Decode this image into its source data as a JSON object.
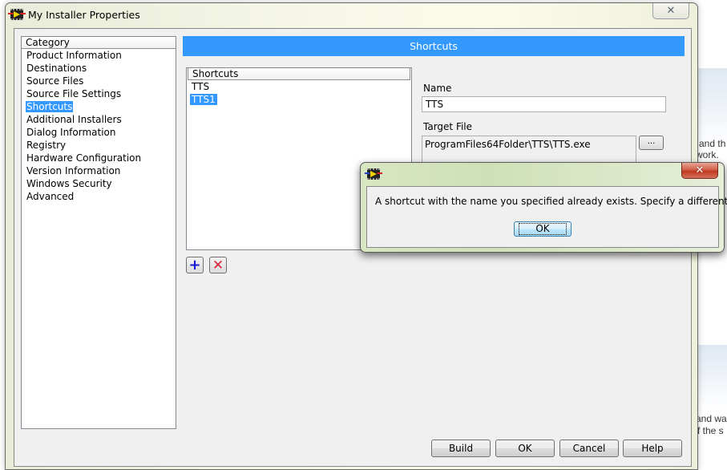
{
  "background": {
    "fragments": [
      "and th",
      "work.",
      "and wa",
      "f the s"
    ]
  },
  "window": {
    "title": "My Installer Properties",
    "close_glyph": "✕"
  },
  "category": {
    "header": "Category",
    "items": [
      {
        "label": "Product Information",
        "selected": false
      },
      {
        "label": "Destinations",
        "selected": false
      },
      {
        "label": "Source Files",
        "selected": false
      },
      {
        "label": "Source File Settings",
        "selected": false
      },
      {
        "label": "Shortcuts",
        "selected": true
      },
      {
        "label": "Additional Installers",
        "selected": false
      },
      {
        "label": "Dialog Information",
        "selected": false
      },
      {
        "label": "Registry",
        "selected": false
      },
      {
        "label": "Hardware Configuration",
        "selected": false
      },
      {
        "label": "Version Information",
        "selected": false
      },
      {
        "label": "Windows Security",
        "selected": false
      },
      {
        "label": "Advanced",
        "selected": false
      }
    ]
  },
  "section": {
    "title": "Shortcuts"
  },
  "shortcuts": {
    "header": "Shortcuts",
    "items": [
      {
        "label": "TTS",
        "selected": false
      },
      {
        "label": "TTS1",
        "selected": true
      }
    ],
    "add_glyph": "+",
    "remove_glyph": "✕"
  },
  "details": {
    "name_label": "Name",
    "name_value": "TTS",
    "target_label": "Target File",
    "target_value": "ProgramFiles64Folder\\TTS\\TTS.exe",
    "browse_label": "..."
  },
  "buttons": {
    "build": "Build",
    "ok": "OK",
    "cancel": "Cancel",
    "help": "Help"
  },
  "message_dialog": {
    "text": "A shortcut with the name you specified already exists. Specify a different name.",
    "ok_label": "OK",
    "close_glyph": "✕"
  },
  "colors": {
    "accent": "#3399ff",
    "dialog_close": "#c0391f"
  }
}
